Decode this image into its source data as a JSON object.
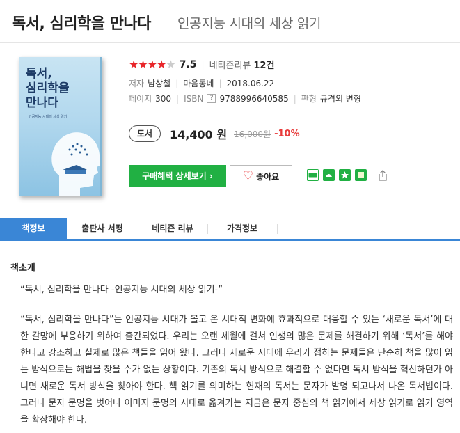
{
  "book": {
    "title": "독서, 심리학을 만나다",
    "subtitle": "인공지능 시대의 세상 읽기",
    "cover": {
      "title_line1": "독서,",
      "title_line2": "심리학을",
      "title_line3": "만나다",
      "subtitle": "인공지능 시대의 세상 읽기"
    },
    "rating": {
      "stars_filled": "★★★★",
      "stars_empty": "★",
      "score": "7.5",
      "review_label": "네티즌리뷰",
      "review_count": "12건",
      "star_value": 3.75
    },
    "author_label": "저자",
    "author": "남상철",
    "publisher": "마음동네",
    "date": "2018.06.22",
    "pages_label": "페이지",
    "pages": "300",
    "isbn_label": "ISBN",
    "isbn_help": "?",
    "isbn": "9788996640585",
    "format_label": "판형",
    "format": "규격외 변형"
  },
  "price": {
    "badge": "도서",
    "current": "14,400 원",
    "original": "16,000원",
    "discount": "-10%"
  },
  "actions": {
    "buy_label": "구매혜택 상세보기 ›",
    "like_label": "좋아요",
    "heart": "♡"
  },
  "tabs": [
    {
      "label": "책정보"
    },
    {
      "label": "출판사 서평"
    },
    {
      "label": "네티즌 리뷰"
    },
    {
      "label": "가격정보"
    }
  ],
  "intro": {
    "heading": "책소개",
    "quote": "“독서, 심리학을 만나다 -인공지능 시대의 세상 읽기-”",
    "body": "“독서, 심리학을 만나다”는 인공지능 시대가 몰고 온 시대적 변화에 효과적으로 대응할 수 있는 ‘새로운 독서’에 대한 갈망에 부응하기 위하여 출간되었다. 우리는 오랜 세월에 걸쳐 인생의 많은 문제를 해결하기 위해 ‘독서’를 해야 한다고 강조하고 실제로 많은 책들을 읽어 왔다. 그러나 새로운 시대에 우리가 접하는 문제들은 단순히 책을 많이 읽는 방식으로는 해법을 찾을 수가 없는 상황이다. 기존의 독서 방식으로 해결할 수 없다면 독서 방식을 혁신하던가 아니면 새로운 독서 방식을 찾아야 한다. 책 읽기를 의미하는 현재의 독서는 문자가 발명 되고나서 나온 독서법이다. 그러나 문자 문명을 벗어나 이미지 문명의 시대로 옮겨가는 지금은 문자 중심의 책 읽기에서 세상 읽기로 읽기 영역을 확장해야 한다."
  },
  "colors": {
    "accent_blue": "#3a86d6",
    "buy_green": "#21b043",
    "star_red": "#e8262a",
    "discount_red": "#e83a3a"
  },
  "icons": [
    "blog-icon",
    "cafe-icon",
    "bookmark-plus-icon",
    "band-icon",
    "share-icon"
  ]
}
